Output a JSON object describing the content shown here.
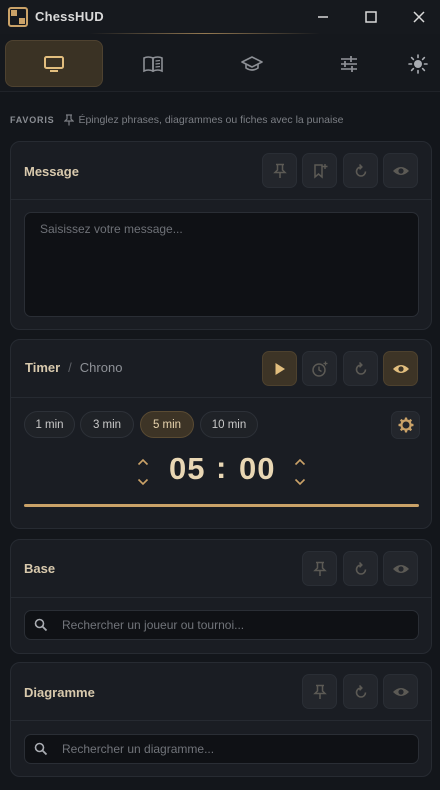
{
  "app": {
    "title": "ChessHUD"
  },
  "window": {
    "minimize_icon": "minimize-icon",
    "maximize_icon": "maximize-icon",
    "close_icon": "close-icon"
  },
  "nav": {
    "tabs": [
      {
        "icon": "monitor-icon",
        "active": true
      },
      {
        "icon": "book-icon",
        "active": false
      },
      {
        "icon": "graduation-cap-icon",
        "active": false
      },
      {
        "icon": "sliders-icon",
        "active": false
      }
    ],
    "theme_icon": "sun-icon"
  },
  "favoris": {
    "label": "FAVORIS",
    "hint": "Épinglez phrases, diagrammes ou fiches avec la punaise"
  },
  "message": {
    "title": "Message",
    "placeholder": "Saisissez votre message..."
  },
  "timer": {
    "title": "Timer",
    "separator": "/",
    "subtitle": "Chrono",
    "presets": [
      {
        "label": "1 min",
        "selected": false
      },
      {
        "label": "3 min",
        "selected": false
      },
      {
        "label": "5 min",
        "selected": true
      },
      {
        "label": "10 min",
        "selected": false
      }
    ],
    "minutes": "05",
    "colon": ":",
    "seconds": "00",
    "progress": 1.0
  },
  "base": {
    "title": "Base",
    "placeholder": "Rechercher un joueur ou tournoi..."
  },
  "diagramme": {
    "title": "Diagramme",
    "placeholder": "Rechercher un diagramme..."
  },
  "colors": {
    "accent": "#caa268",
    "background": "#13161b",
    "card": "#1a1d23",
    "active_button": "#3d3426"
  }
}
